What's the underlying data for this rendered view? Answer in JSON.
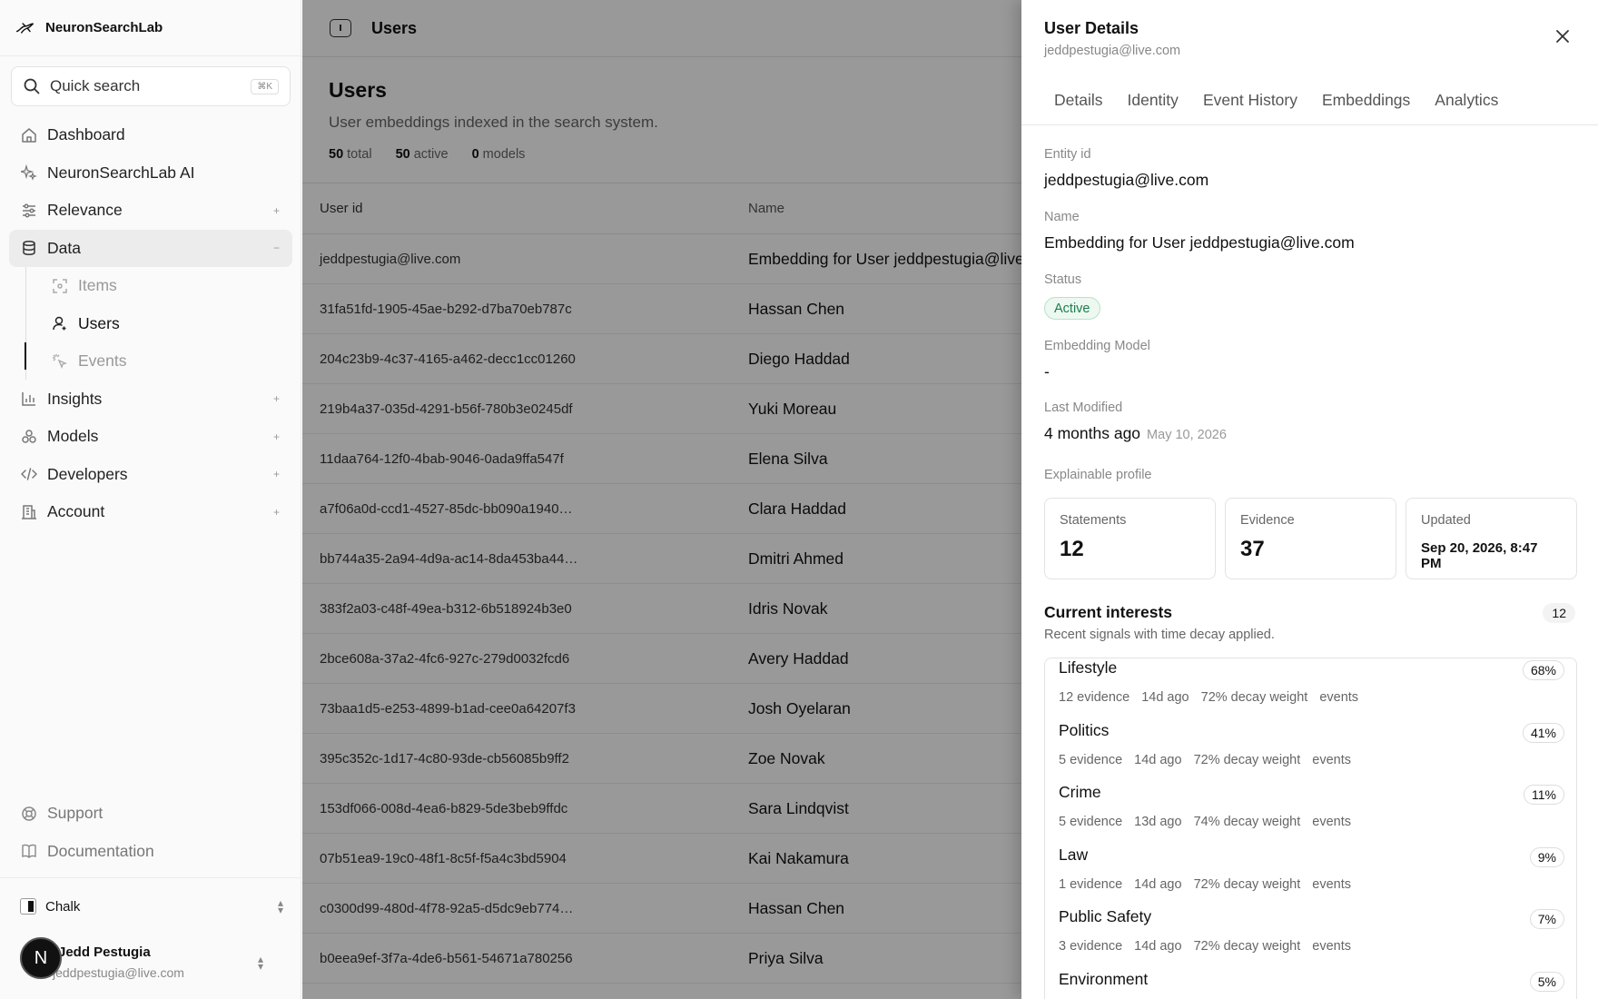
{
  "sidebar": {
    "brand": "NeuronSearchLab",
    "search_label": "Quick search",
    "search_shortcut": "⌘K",
    "nav": [
      {
        "label": "Dashboard",
        "icon": "home-icon"
      },
      {
        "label": "NeuronSearchLab AI",
        "icon": "sparkle-icon"
      },
      {
        "label": "Relevance",
        "icon": "sliders-icon",
        "expand": "+"
      },
      {
        "label": "Data",
        "icon": "database-icon",
        "expand": "−"
      }
    ],
    "data_sub": [
      {
        "label": "Items",
        "icon": "scan-icon"
      },
      {
        "label": "Users",
        "icon": "user-icon"
      },
      {
        "label": "Events",
        "icon": "click-icon"
      }
    ],
    "nav2": [
      {
        "label": "Insights",
        "icon": "chart-icon",
        "expand": "+"
      },
      {
        "label": "Models",
        "icon": "models-icon",
        "expand": "+"
      },
      {
        "label": "Developers",
        "icon": "code-icon",
        "expand": "+"
      },
      {
        "label": "Account",
        "icon": "building-icon",
        "expand": "+"
      }
    ],
    "bottom": [
      {
        "label": "Support",
        "icon": "lifebuoy-icon"
      },
      {
        "label": "Documentation",
        "icon": "book-icon"
      }
    ],
    "workspace": "Chalk",
    "user": {
      "initial": "N",
      "name": "Jedd Pestugia",
      "email": "jeddpestugia@live.com"
    }
  },
  "main": {
    "breadcrumb": "Users",
    "title": "Users",
    "subtitle": "User embeddings indexed in the search system.",
    "stats": [
      {
        "value": "50",
        "label": "total"
      },
      {
        "value": "50",
        "label": "active"
      },
      {
        "value": "0",
        "label": "models"
      }
    ],
    "columns": [
      "User id",
      "Name"
    ],
    "rows": [
      [
        "jeddpestugia@live.com",
        "Embedding for User jeddpestugia@live.com"
      ],
      [
        "31fa51fd-1905-45ae-b292-d7ba70eb787c",
        "Hassan Chen"
      ],
      [
        "204c23b9-4c37-4165-a462-decc1cc01260",
        "Diego Haddad"
      ],
      [
        "219b4a37-035d-4291-b56f-780b3e0245df",
        "Yuki Moreau"
      ],
      [
        "11daa764-12f0-4bab-9046-0ada9ffa547f",
        "Elena Silva"
      ],
      [
        "a7f06a0d-ccd1-4527-85dc-bb090a1940…",
        "Clara Haddad"
      ],
      [
        "bb744a35-2a94-4d9a-ac14-8da453ba44…",
        "Dmitri Ahmed"
      ],
      [
        "383f2a03-c48f-49ea-b312-6b518924b3e0",
        "Idris Novak"
      ],
      [
        "2bce608a-37a2-4fc6-927c-279d0032fcd6",
        "Avery Haddad"
      ],
      [
        "73baa1d5-e253-4899-b1ad-cee0a64207f3",
        "Josh Oyelaran"
      ],
      [
        "395c352c-1d17-4c80-93de-cb56085b9ff2",
        "Zoe Novak"
      ],
      [
        "153df066-008d-4ea6-b829-5de3beb9ffdc",
        "Sara Lindqvist"
      ],
      [
        "07b51ea9-19c0-48f1-8c5f-f5a4c3bd5904",
        "Kai Nakamura"
      ],
      [
        "c0300d99-480d-4f78-92a5-d5dc9eb774…",
        "Hassan Chen"
      ],
      [
        "b0eea9ef-3f7a-4de6-b561-54671a780256",
        "Priya Silva"
      ]
    ]
  },
  "drawer": {
    "title": "User Details",
    "subtitle": "jeddpestugia@live.com",
    "tabs": [
      "Details",
      "Identity",
      "Event History",
      "Embeddings",
      "Analytics"
    ],
    "fields": {
      "entity_label": "Entity id",
      "entity_value": "jeddpestugia@live.com",
      "name_label": "Name",
      "name_value": "Embedding for User jeddpestugia@live.com",
      "status_label": "Status",
      "status_value": "Active",
      "model_label": "Embedding Model",
      "model_value": "-",
      "modified_label": "Last Modified",
      "modified_relative": "4 months ago",
      "modified_date": "May 10, 2026",
      "profile_label": "Explainable profile"
    },
    "cards": [
      {
        "label": "Statements",
        "value": "12"
      },
      {
        "label": "Evidence",
        "value": "37"
      },
      {
        "label": "Updated",
        "value": "Sep 20, 2026, 8:47 PM"
      }
    ],
    "interests_title": "Current interests",
    "interests_count": "12",
    "interests_sub": "Recent signals with time decay applied.",
    "interests": [
      {
        "name": "Lifestyle",
        "pct": "68%",
        "evidence": "12 evidence",
        "age": "14d ago",
        "decay": "72% decay weight",
        "source": "events"
      },
      {
        "name": "Politics",
        "pct": "41%",
        "evidence": "5 evidence",
        "age": "14d ago",
        "decay": "72% decay weight",
        "source": "events"
      },
      {
        "name": "Crime",
        "pct": "11%",
        "evidence": "5 evidence",
        "age": "13d ago",
        "decay": "74% decay weight",
        "source": "events"
      },
      {
        "name": "Law",
        "pct": "9%",
        "evidence": "1 evidence",
        "age": "14d ago",
        "decay": "72% decay weight",
        "source": "events"
      },
      {
        "name": "Public Safety",
        "pct": "7%",
        "evidence": "3 evidence",
        "age": "14d ago",
        "decay": "72% decay weight",
        "source": "events"
      },
      {
        "name": "Environment",
        "pct": "5%",
        "evidence": "",
        "age": "",
        "decay": "",
        "source": ""
      }
    ]
  },
  "colors": {
    "status_active": "#1a7f4b",
    "overlay": "rgba(0,0,0,0.40)"
  }
}
